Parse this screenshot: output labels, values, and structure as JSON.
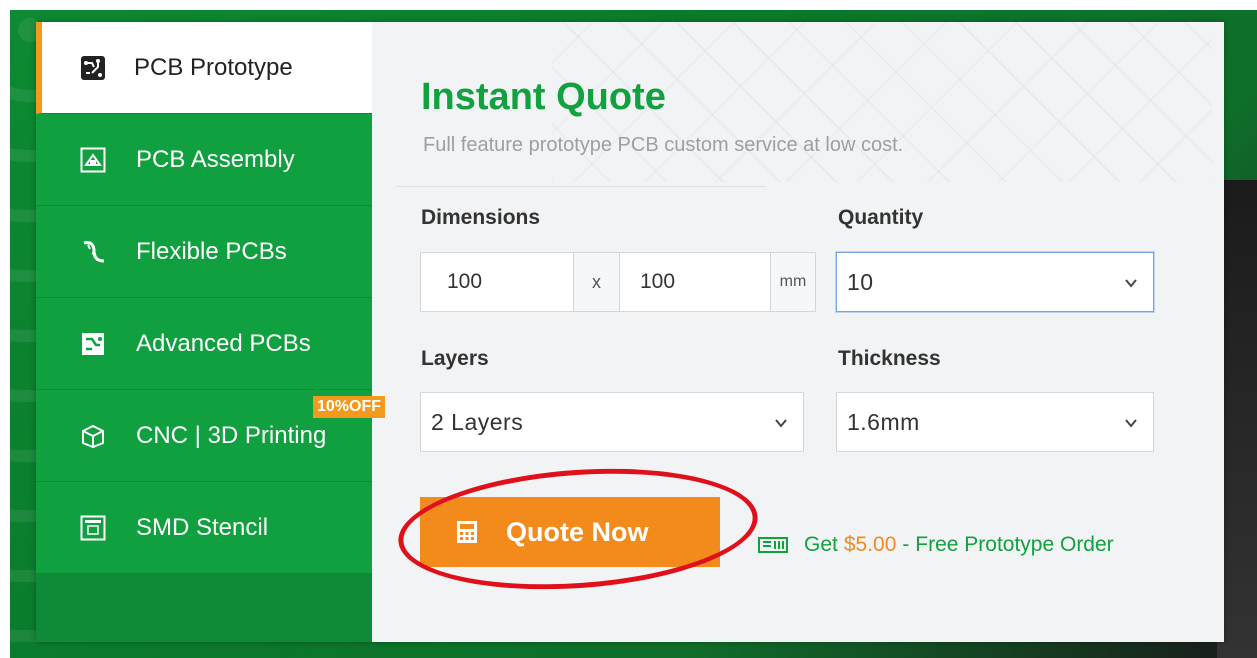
{
  "sidebar": {
    "items": [
      {
        "label": "PCB Prototype",
        "icon": "pcb-prototype-icon",
        "active": true
      },
      {
        "label": "PCB Assembly",
        "icon": "pcb-assembly-icon"
      },
      {
        "label": "Flexible PCBs",
        "icon": "flexible-pcb-icon"
      },
      {
        "label": "Advanced PCBs",
        "icon": "advanced-pcb-icon"
      },
      {
        "label": "CNC | 3D Printing",
        "icon": "cnc-3d-icon",
        "badge": "10%OFF"
      },
      {
        "label": "SMD Stencil",
        "icon": "smd-stencil-icon"
      }
    ]
  },
  "main": {
    "title": "Instant Quote",
    "subtitle": "Full feature prototype PCB custom service at low cost.",
    "dimensions": {
      "label": "Dimensions",
      "width": "100",
      "separator": "x",
      "height": "100",
      "unit": "mm"
    },
    "quantity": {
      "label": "Quantity",
      "value": "10"
    },
    "layers": {
      "label": "Layers",
      "value": "2 Layers"
    },
    "thickness": {
      "label": "Thickness",
      "value": "1.6mm"
    },
    "quote_button": "Quote Now",
    "promo": {
      "prefix": "Get",
      "amount": "$5.00",
      "suffix": "- Free Prototype Order"
    }
  },
  "colors": {
    "green": "#10a040",
    "orange": "#f28b1b",
    "highlight": "#e0101a"
  }
}
